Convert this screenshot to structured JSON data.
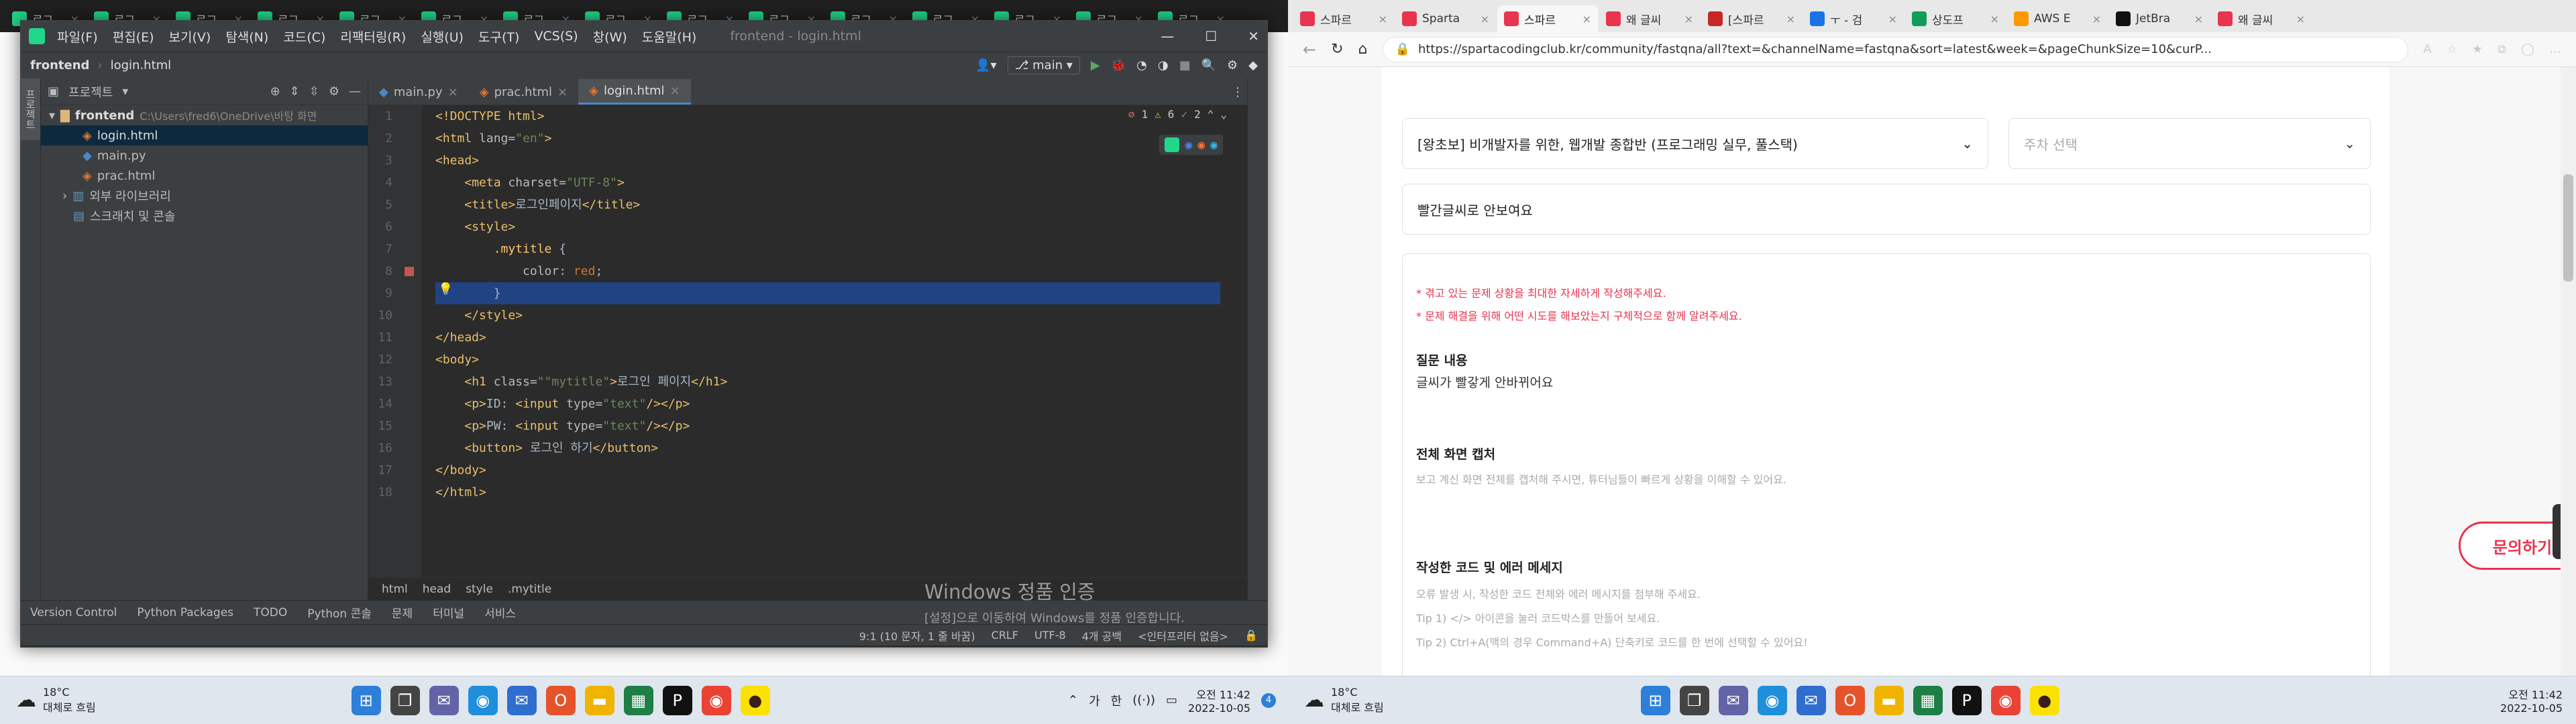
{
  "left_browser_tabs": [
    "로그",
    "로그",
    "로그",
    "로그",
    "로그",
    "로그",
    "로그",
    "로그",
    "로그",
    "로그",
    "로그",
    "로그",
    "로그",
    "로그",
    "로그"
  ],
  "ide": {
    "menu": [
      "파일(F)",
      "편집(E)",
      "보기(V)",
      "탐색(N)",
      "코드(C)",
      "리팩터링(R)",
      "실행(U)",
      "도구(T)",
      "VCS(S)",
      "창(W)",
      "도움말(H)"
    ],
    "title_text": "frontend - login.html",
    "nav": {
      "project": "frontend",
      "file": "login.html",
      "branch": "main"
    },
    "project_panel": {
      "title": "프로젝트",
      "root": "frontend",
      "root_path": "C:\\Users\\fred6\\OneDrive\\바탕 화면",
      "files": [
        "login.html",
        "main.py",
        "prac.html"
      ],
      "ext_lib": "외부 라이브러리",
      "scratch": "스크래치 및 콘솔"
    },
    "editor_tabs": [
      "main.py",
      "prac.html",
      "login.html"
    ],
    "inspection": {
      "errors": "1",
      "warnings": "6",
      "weak": "2"
    },
    "line_numbers": [
      "1",
      "2",
      "3",
      "4",
      "5",
      "6",
      "7",
      "8",
      "9",
      "10",
      "11",
      "12",
      "13",
      "14",
      "15",
      "16",
      "17",
      "18"
    ],
    "breadcrumb": [
      "html",
      "head",
      "style",
      ".mytitle"
    ],
    "bottom_tools": [
      "Version Control",
      "Python Packages",
      "TODO",
      "Python 콘솔",
      "문제",
      "터미널",
      "서비스"
    ],
    "status": {
      "pos": "9:1 (10 문자, 1 줄 바꿈)",
      "eol": "CRLF",
      "enc": "UTF-8",
      "indent": "4개 공백",
      "interp": "<인터프리터 없음>"
    },
    "activation_title": "Windows 정품 인증",
    "activation_body": "[설정]으로 이동하여 Windows를 정품 인증합니다."
  },
  "code_lines": [
    [
      [
        "t-tag",
        "<!DOCTYPE html>"
      ]
    ],
    [
      [
        "t-tag",
        "<html "
      ],
      [
        "t-attr",
        "lang="
      ],
      [
        "t-str",
        "\"en\""
      ],
      [
        "t-tag",
        ">"
      ]
    ],
    [
      [
        "t-tag",
        "<head>"
      ]
    ],
    [
      [
        "",
        "    "
      ],
      [
        "t-tag",
        "<meta "
      ],
      [
        "t-attr",
        "charset="
      ],
      [
        "t-str",
        "\"UTF-8\""
      ],
      [
        "t-tag",
        ">"
      ]
    ],
    [
      [
        "",
        "    "
      ],
      [
        "t-tag",
        "<title>"
      ],
      [
        "",
        "로그인페이지"
      ],
      [
        "t-tag",
        "</title>"
      ]
    ],
    [
      [
        "",
        "    "
      ],
      [
        "t-tag",
        "<style>"
      ]
    ],
    [
      [
        "",
        "        "
      ],
      [
        "t-cls",
        ".mytitle"
      ],
      [
        "",
        " {"
      ]
    ],
    [
      [
        "",
        "            "
      ],
      [
        "t-prop",
        "color"
      ],
      [
        "",
        ": "
      ],
      [
        "t-css",
        "red"
      ],
      [
        "",
        ";"
      ]
    ],
    [
      [
        "",
        "        }"
      ]
    ],
    [
      [
        "",
        "    "
      ],
      [
        "t-tag",
        "</style>"
      ]
    ],
    [
      [
        "t-tag",
        "</head>"
      ]
    ],
    [
      [
        "t-tag",
        "<body>"
      ]
    ],
    [
      [
        "",
        "    "
      ],
      [
        "t-tag",
        "<h1 "
      ],
      [
        "t-attr",
        "class="
      ],
      [
        "t-str",
        "\"\"mytitle\""
      ],
      [
        "t-tag",
        ">"
      ],
      [
        "",
        "로그인 페이지"
      ],
      [
        "t-tag",
        "</h1>"
      ]
    ],
    [
      [
        "",
        "    "
      ],
      [
        "t-tag",
        "<p>"
      ],
      [
        "",
        "ID: "
      ],
      [
        "t-tag",
        "<input "
      ],
      [
        "t-attr",
        "type="
      ],
      [
        "t-str",
        "\"text\""
      ],
      [
        "t-tag",
        "/></p>"
      ]
    ],
    [
      [
        "",
        "    "
      ],
      [
        "t-tag",
        "<p>"
      ],
      [
        "",
        "PW: "
      ],
      [
        "t-tag",
        "<input "
      ],
      [
        "t-attr",
        "type="
      ],
      [
        "t-str",
        "\"text\""
      ],
      [
        "t-tag",
        "/></p>"
      ]
    ],
    [
      [
        "",
        "    "
      ],
      [
        "t-tag",
        "<button>"
      ],
      [
        "",
        " 로그인 하기"
      ],
      [
        "t-tag",
        "</button>"
      ]
    ],
    [
      [
        "t-tag",
        "</body>"
      ]
    ],
    [
      [
        "t-tag",
        "</html>"
      ]
    ]
  ],
  "left_taskbar": {
    "weather_temp": "18°C",
    "weather_desc": "대체로 흐림",
    "ime1": "가",
    "ime2": "한",
    "time": "오전 11:42",
    "date": "2022-10-05",
    "notif": "4"
  },
  "right_browser": {
    "tabs": [
      "스파르",
      "Sparta",
      "스파르",
      "왜 글씨",
      "[스파르",
      "ㅜ - 검",
      "상도프",
      "AWS E",
      "JetBra",
      "왜 글씨"
    ],
    "url": "https://spartacodingclub.kr/community/fastqna/all?text=&channelName=fastqna&sort=latest&week=&pageChunkSize=10&curP...",
    "course_select": "[왕초보] 비개발자를 위한, 웹개발 종합반 (프로그래밍 실무, 풀스택)",
    "week_placeholder": "주차 선택",
    "title_value": "빨간글씨로 안보여요",
    "notice1": "* 겪고 있는 문제 상황을 최대한 자세하게 작성해주세요.",
    "notice2": "* 문제 해결을 위해 어떤 시도를 해보았는지 구체적으로 함께 알려주세요.",
    "q_label": "질문 내용",
    "q_value": "글씨가 빨갛게 안바뀌어요",
    "shot_label": "전체 화면 캡처",
    "shot_help": "보고 계신 화면 전체를 캡처해 주시면, 튜터님들이 빠르게 상황을 이해할 수 있어요.",
    "code_label": "작성한 코드 및 에러 메세지",
    "code_help": "오류 발생 시, 작성한 코드 전체와 에러 메시지를 첨부해 주세요.",
    "tip1": "Tip 1) </> 아이콘을 눌러 코드박스를 만들어 보세요.",
    "tip2": "Tip 2) Ctrl+A(맥의 경우 Command+A) 단축키로 코드를 한 번에 선택할 수 있어요!",
    "ask_button": "문의하기"
  },
  "right_taskbar": {
    "weather_temp": "18°C",
    "weather_desc": "대체로 흐림",
    "time": "오전 11:42",
    "date": "2022-10-05"
  }
}
